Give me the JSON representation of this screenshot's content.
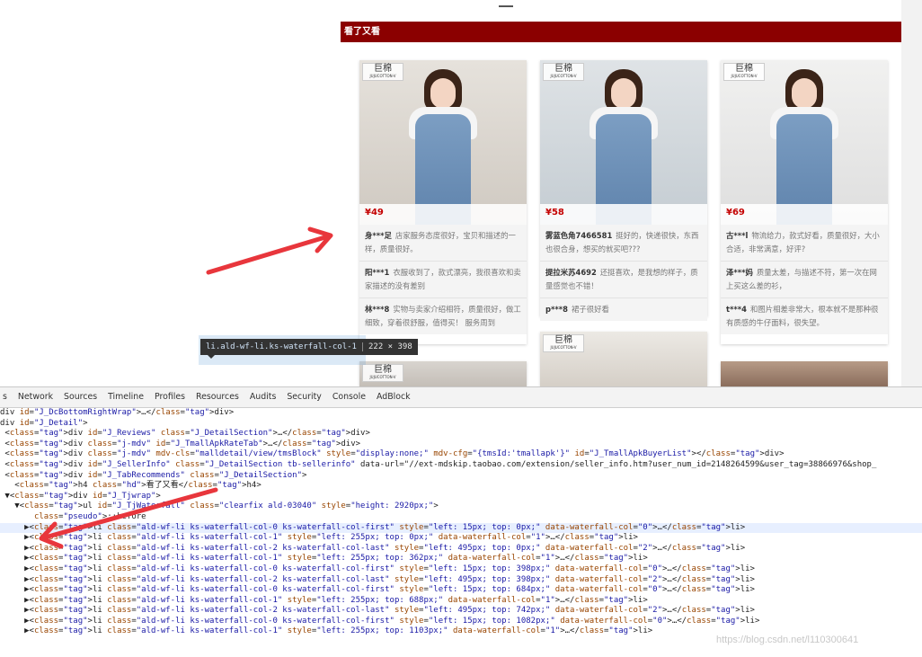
{
  "section": {
    "title": "看了又看",
    "header_color": "#8b0000",
    "price_color": "#c40000"
  },
  "cards": [
    {
      "brand": "巨棉",
      "brand_sub": "JUJUCOTTON-V",
      "price": "¥49",
      "reviews": [
        {
          "user": "身***足",
          "text": "店家服务态度很好，宝贝和描述的一样，质量很好。"
        },
        {
          "user": "阳***1",
          "text": "衣服收到了，款式漂亮，我很喜欢和卖家描述的没有差别"
        },
        {
          "user": "林***8",
          "text": "实物与卖家介绍相符，质量很好，做工细致，穿着很舒服，值得买！ 服务周到"
        }
      ]
    },
    {
      "brand": "巨棉",
      "brand_sub": "JUJUCOTTON-V",
      "price": "¥58",
      "reviews": [
        {
          "user": "雾蓝色角7466581",
          "text": "挺好的，快递很快，东西也很合身，想买的就买吧???"
        },
        {
          "user": "提拉米苏4692",
          "text": "还挺喜欢，是我想的样子，质量感觉也不错！"
        },
        {
          "user": "p***8",
          "text": "裙子很好看"
        }
      ]
    },
    {
      "brand": "巨棉",
      "brand_sub": "JUJUCOTTON-V",
      "price": "¥69",
      "reviews": [
        {
          "user": "古***l",
          "text": "物流给力，款式好看，质量很好，大小合适，非常满意，好评?"
        },
        {
          "user": "泽***妈",
          "text": "质量太差，与描述不符，第一次在网上买这么差的衫，"
        },
        {
          "user": "t***4",
          "text": "和图片相差非常大，根本就不是那种很有质感的牛仔面料，很失望。"
        }
      ]
    }
  ],
  "bottom_cards": [
    {
      "brand": "巨棉",
      "brand_sub": "JUJUCOTTON-V"
    },
    {
      "brand": "巨棉",
      "brand_sub": "JUJUCOTTON-V"
    },
    {
      "brand": "",
      "brand_sub": ""
    }
  ],
  "tooltip": {
    "selector": "li.ald-wf-li.ks-waterfall-col-1",
    "size": "222 × 398"
  },
  "devtools": {
    "tabs": [
      "s",
      "Network",
      "Sources",
      "Timeline",
      "Profiles",
      "Resources",
      "Audits",
      "Security",
      "Console",
      "AdBlock"
    ],
    "lines": [
      "div id=\"J_DcBottomRightWrap\">…</div>",
      "div id=\"J_Detail\">",
      " <div id=\"J_Reviews\" class=\"J_DetailSection\">…</div>",
      " <div class=\"j-mdv\" id=\"J_TmallApkRateTab\">…</div>",
      " <div class=\"j-mdv\" mdv-cls=\"malldetail/view/tmsBlock\" style=\"display:none;\" mdv-cfg=\"{tmsId:'tmallapk'}\" id=\"J_TmallApkBuyerList\"></div>",
      " <div id=\"J_SellerInfo\" class=\"J_DetailSection tb-sellerinfo\" data-url=\"//ext-mdskip.taobao.com/extension/seller_info.htm?user_num_id=2148264599&user_tag=38866976&shop_",
      " <div id=\"J_TabRecommends\" class=\"J_DetailSection\">",
      "   <h4 class=\"hd\">看了又看</h4>",
      " ▼<div id=\"J_Tjwrap\">",
      "   ▼<ul id=\"J_TjWaterfall\" class=\"clearfix ald-03040\" style=\"height: 2920px;\">",
      "       ::before",
      "     ▶<li class=\"ald-wf-li ks-waterfall-col-0 ks-waterfall-col-first\" style=\"left: 15px; top: 0px;\" data-waterfall-col=\"0\">…</li>",
      "     ▶<li class=\"ald-wf-li ks-waterfall-col-1\" style=\"left: 255px; top: 0px;\" data-waterfall-col=\"1\">…</li>",
      "     ▶<li class=\"ald-wf-li ks-waterfall-col-2 ks-waterfall-col-last\" style=\"left: 495px; top: 0px;\" data-waterfall-col=\"2\">…</li>",
      "     ▶<li class=\"ald-wf-li ks-waterfall-col-1\" style=\"left: 255px; top: 362px;\" data-waterfall-col=\"1\">…</li>",
      "     ▶<li class=\"ald-wf-li ks-waterfall-col-0 ks-waterfall-col-first\" style=\"left: 15px; top: 398px;\" data-waterfall-col=\"0\">…</li>",
      "     ▶<li class=\"ald-wf-li ks-waterfall-col-2 ks-waterfall-col-last\" style=\"left: 495px; top: 398px;\" data-waterfall-col=\"2\">…</li>",
      "     ▶<li class=\"ald-wf-li ks-waterfall-col-0 ks-waterfall-col-first\" style=\"left: 15px; top: 684px;\" data-waterfall-col=\"0\">…</li>",
      "     ▶<li class=\"ald-wf-li ks-waterfall-col-1\" style=\"left: 255px; top: 688px;\" data-waterfall-col=\"1\">…</li>",
      "     ▶<li class=\"ald-wf-li ks-waterfall-col-2 ks-waterfall-col-last\" style=\"left: 495px; top: 742px;\" data-waterfall-col=\"2\">…</li>",
      "     ▶<li class=\"ald-wf-li ks-waterfall-col-0 ks-waterfall-col-first\" style=\"left: 15px; top: 1082px;\" data-waterfall-col=\"0\">…</li>",
      "     ▶<li class=\"ald-wf-li ks-waterfall-col-1\" style=\"left: 255px; top: 1103px;\" data-waterfall-col=\"1\">…</li>"
    ]
  },
  "watermark": "https://blog.csdn.net/l110300641",
  "annotation_color": "#e8363c"
}
